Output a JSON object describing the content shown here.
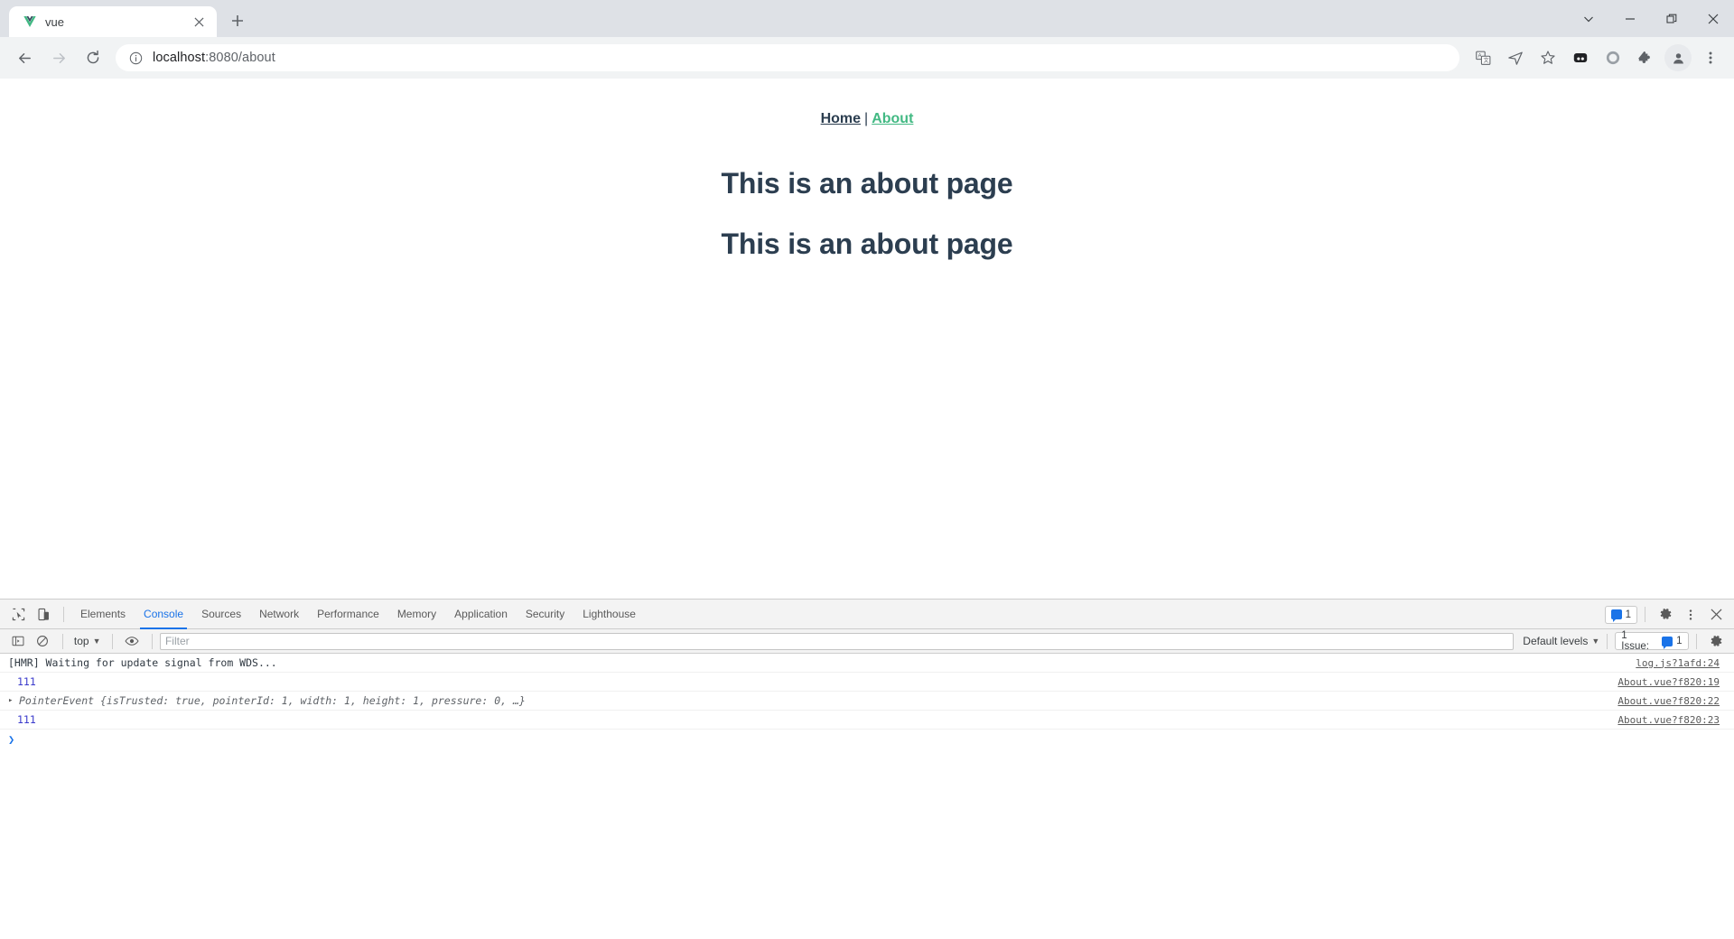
{
  "browser": {
    "tab": {
      "title": "vue",
      "favicon": "vue-logo-icon",
      "close_label": "×"
    },
    "new_tab_label": "+",
    "window_controls": [
      {
        "name": "tab-search",
        "glyph": "⌄"
      },
      {
        "name": "minimize",
        "glyph": "—"
      },
      {
        "name": "maximize",
        "glyph": "❐"
      },
      {
        "name": "close",
        "glyph": "×"
      }
    ],
    "nav": {
      "back": "back-arrow",
      "forward": "forward-arrow",
      "reload": "reload-icon"
    },
    "omnibox": {
      "security_icon": "info-circle-icon",
      "host": "localhost",
      "path": ":8080/about",
      "full_url": "localhost:8080/about"
    },
    "toolbar_icons": [
      {
        "name": "translate-icon",
        "title": "Translate"
      },
      {
        "name": "send-page-icon",
        "title": "Send"
      },
      {
        "name": "bookmark-star-icon",
        "title": "Bookmark"
      },
      {
        "name": "extension-dark-icon",
        "title": "Extension"
      },
      {
        "name": "circle-icon",
        "title": "Extension"
      },
      {
        "name": "puzzle-icon",
        "title": "Extensions"
      },
      {
        "name": "profile-avatar-icon",
        "title": "Profile"
      },
      {
        "name": "more-menu-icon",
        "title": "Customize and control"
      }
    ]
  },
  "page": {
    "nav": {
      "home_label": "Home",
      "divider": "|",
      "about_label": "About"
    },
    "headings": [
      "This is an about page",
      "This is an about page"
    ],
    "colors": {
      "accent_green": "#42b983",
      "text_dark": "#2c3e50"
    }
  },
  "devtools": {
    "tools": [
      {
        "name": "inspect-element-icon"
      },
      {
        "name": "device-toolbar-icon"
      }
    ],
    "tabs": [
      {
        "label": "Elements",
        "active": false
      },
      {
        "label": "Console",
        "active": true
      },
      {
        "label": "Sources",
        "active": false
      },
      {
        "label": "Network",
        "active": false
      },
      {
        "label": "Performance",
        "active": false
      },
      {
        "label": "Memory",
        "active": false
      },
      {
        "label": "Application",
        "active": false
      },
      {
        "label": "Security",
        "active": false
      },
      {
        "label": "Lighthouse",
        "active": false
      }
    ],
    "header_right": {
      "message_count": "1",
      "settings_icon": "gear-icon",
      "more_icon": "more-vertical-icon",
      "close_icon": "close-icon"
    },
    "filterbar": {
      "sidebar_toggle": "console-sidebar-icon",
      "clear_console": "clear-console-icon",
      "context": "top",
      "eye_icon": "live-expression-icon",
      "filter_placeholder": "Filter",
      "filter_value": "",
      "levels": "Default levels",
      "issues_label": "1 Issue:",
      "issues_count": "1",
      "console_settings_icon": "gear-icon"
    },
    "messages": [
      {
        "kind": "log",
        "text": "[HMR] Waiting for update signal from WDS...",
        "source": "log.js?1afd:24",
        "expandable": false
      },
      {
        "kind": "number",
        "text": "111",
        "source": "About.vue?f820:19",
        "expandable": false
      },
      {
        "kind": "object",
        "class_name": "PointerEvent",
        "preview_prefix": " {isTrusted: ",
        "props": [
          {
            "key": "isTrusted",
            "value": "true"
          },
          {
            "key": "pointerId",
            "value": "1"
          },
          {
            "key": "width",
            "value": "1"
          },
          {
            "key": "height",
            "value": "1"
          },
          {
            "key": "pressure",
            "value": "0"
          }
        ],
        "text": "PointerEvent {isTrusted: true, pointerId: 1, width: 1, height: 1, pressure: 0, …}",
        "source": "About.vue?f820:22",
        "expandable": true,
        "arrow": "▸"
      },
      {
        "kind": "number",
        "text": "111",
        "source": "About.vue?f820:23",
        "expandable": false
      }
    ],
    "prompt_glyph": "❯"
  }
}
